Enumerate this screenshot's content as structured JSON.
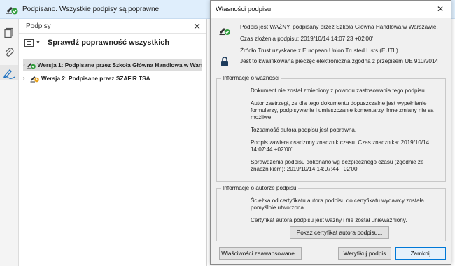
{
  "notification": {
    "text": "Podpisano. Wszystkie podpisy są poprawne."
  },
  "signatures_panel": {
    "title": "Podpisy",
    "close_glyph": "✕",
    "verify_all_label": "Sprawdź poprawność wszystkich",
    "options_caret": "▼",
    "rows": [
      {
        "chevron": "›",
        "label": "Wersja 1: Podpisane przez Szkoła Główna Handlowa w Warszawie",
        "icon": "signature-valid-icon",
        "selected": true
      },
      {
        "chevron": "›",
        "label": "Wersja 2: Podpisane przez SZAFIR TSA",
        "icon": "signature-timestamp-icon",
        "selected": false
      }
    ]
  },
  "dialog": {
    "title": "Własności podpisu",
    "close_glyph": "✕",
    "header_lines": [
      "Podpis jest WAŻNY, podpisany przez Szkoła Główna Handlowa w Warszawie.",
      "Czas złożenia podpisu: 2019/10/14 14:07:23 +02'00'",
      "Źródło Trust uzyskane z European Union Trusted Lists (EUTL)."
    ],
    "eu_line": "Jest to kwalifikowana pieczęć elektroniczna zgodna z przepisem UE 910/2014",
    "validity_group": {
      "label": "Informacje o ważności",
      "paragraphs": [
        "Dokument nie został zmieniony z powodu zastosowania tego podpisu.",
        "Autor zastrzegł, że dla tego dokumentu dopuszczalne jest wypełnianie formularzy, podpisywanie i umieszczanie komentarzy. Inne zmiany nie są możliwe.",
        "Tożsamość autora podpisu jest poprawna.",
        "Podpis zawiera osadzony znacznik czasu. Czas znacznika: 2019/10/14 14:07:44 +02'00'",
        "Sprawdzenia podpisu dokonano wg bezpiecznego czasu (zgodnie ze znacznikiem): 2019/10/14 14:07:44 +02'00'"
      ]
    },
    "author_group": {
      "label": "Informacje o autorze podpisu",
      "paragraphs": [
        "Ścieżka od certyfikatu autora podpisu do certyfikatu wydawcy została pomyślnie utworzona.",
        "Certyfikat autora podpisu jest ważny i nie został unieważniony."
      ],
      "show_cert_button": "Pokaż certyfikat autora podpisu..."
    },
    "buttons": {
      "advanced": "Właściwości zaawansowane...",
      "verify": "Weryfikuj podpis",
      "close": "Zamknij"
    }
  },
  "colors": {
    "valid_green": "#2e9b3a",
    "notif_bg": "#dfeefc",
    "focus_blue": "#0078d7"
  }
}
